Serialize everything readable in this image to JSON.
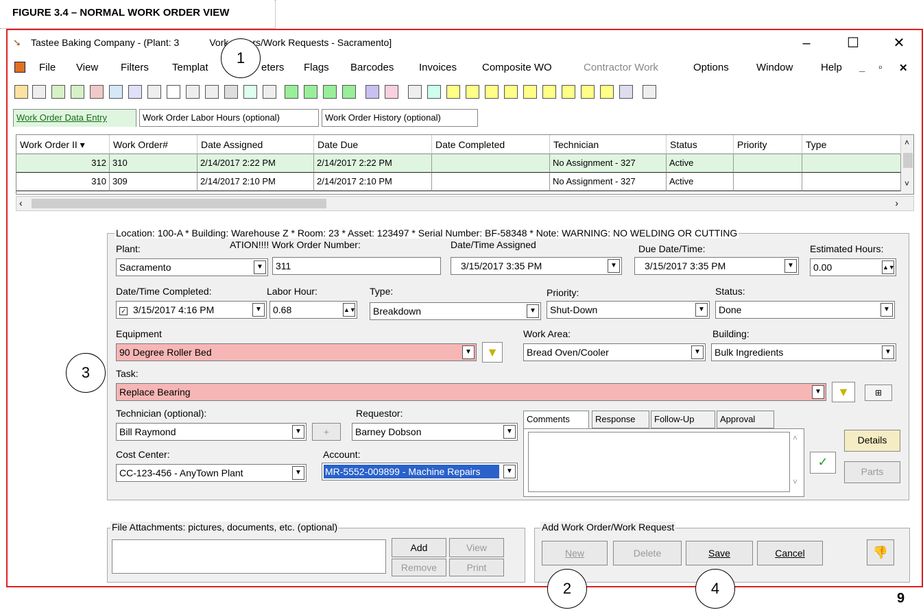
{
  "figure_caption": "FIGURE 3.4 – NORMAL WORK ORDER VIEW",
  "page_number": "9",
  "window": {
    "title": "Tastee Baking Company - (Plant: 3",
    "title_rest": "Vork Orders/Work Requests - Sacramento]",
    "minimize": "–",
    "maximize": "☐",
    "close": "✕"
  },
  "menu": {
    "items": [
      "File",
      "View",
      "Filters",
      "Templat",
      "eters",
      "Flags",
      "Barcodes",
      "Invoices",
      "Composite WO",
      "Contractor Work",
      "Options",
      "Window",
      "Help"
    ],
    "right_controls": [
      "_",
      "▫",
      "✕"
    ]
  },
  "tabs": [
    "Work Order Data Entry",
    "Work Order Labor Hours (optional)",
    "Work Order History (optional)"
  ],
  "grid": {
    "columns": [
      "Work Order II",
      "Work Order#",
      "Date Assigned",
      "Date Due",
      "Date Completed",
      "Technician",
      "Status",
      "Priority",
      "Type"
    ],
    "rows": [
      [
        "312",
        "310",
        "2/14/2017 2:22 PM",
        "2/14/2017 2:22 PM",
        "",
        "No Assignment - 327",
        "Active",
        "",
        ""
      ],
      [
        "310",
        "309",
        "2/14/2017 2:10 PM",
        "2/14/2017 2:10 PM",
        "",
        "No Assignment - 327",
        "Active",
        "",
        ""
      ]
    ]
  },
  "form": {
    "location_line": "Location: 100-A * Building: Warehouse Z * Room: 23 * Asset: 123497 * Serial Number: BF-58348 * Note: WARNING: NO WELDING OR CUTTING",
    "plant_label": "Plant:",
    "plant_value": "Sacramento",
    "won_label": "ATION!!!! Work Order Number:",
    "won_value": "311",
    "assigned_label": "Date/Time Assigned",
    "assigned_value": "3/15/2017   3:35 PM",
    "due_label": "Due Date/Time:",
    "due_value": "3/15/2017   3:35 PM",
    "est_label": "Estimated Hours:",
    "est_value": "0.00",
    "completed_label": "Date/Time Completed:",
    "completed_value": "3/15/2017   4:16 PM",
    "labor_label": "Labor Hour:",
    "labor_value": "0.68",
    "type_label": "Type:",
    "type_value": "Breakdown",
    "priority_label": "Priority:",
    "priority_value": "Shut-Down",
    "status_label": "Status:",
    "status_value": "Done",
    "equipment_label": "Equipment",
    "equipment_value": "90 Degree Roller Bed",
    "workarea_label": "Work Area:",
    "workarea_value": "Bread Oven/Cooler",
    "building_label": "Building:",
    "building_value": "Bulk Ingredients",
    "task_label": "Task:",
    "task_value": "Replace Bearing",
    "technician_label": "Technician (optional):",
    "technician_value": "Bill Raymond",
    "requestor_label": "Requestor:",
    "requestor_value": "Barney Dobson",
    "costcenter_label": "Cost Center:",
    "costcenter_value": "CC-123-456 - AnyTown Plant",
    "account_label": "Account:",
    "account_value": "MR-5552-009899 - Machine Repairs",
    "comment_tabs": [
      "Comments",
      "Response",
      "Follow-Up",
      "Approval"
    ],
    "details_label": "Details",
    "parts_label": "Parts"
  },
  "attachments": {
    "title": "File Attachments: pictures, documents, etc. (optional)",
    "add": "Add",
    "view": "View",
    "remove": "Remove",
    "print": "Print"
  },
  "actions": {
    "title": "Add Work Order/Work Request",
    "new": "New",
    "delete": "Delete",
    "save": "Save",
    "cancel": "Cancel"
  },
  "callouts": [
    "1",
    "2",
    "3",
    "4"
  ],
  "colors": {
    "window_border": "#e02020",
    "required_field": "#f7b6b6",
    "grid_selected": "#dff5df"
  }
}
